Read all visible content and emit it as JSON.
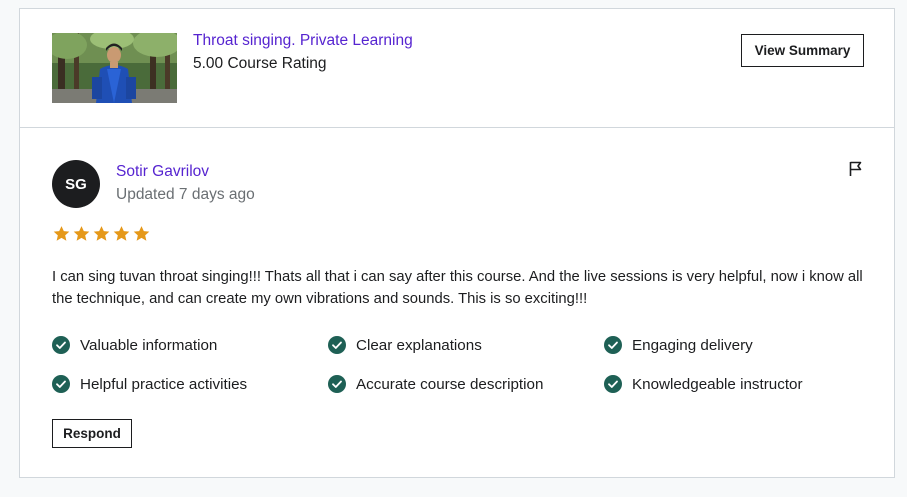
{
  "course": {
    "title": "Throat singing. Private Learning",
    "rating_text": "5.00 Course Rating",
    "view_summary_label": "View Summary",
    "thumbnail_icon": "course-thumbnail-image"
  },
  "review": {
    "avatar_initials": "SG",
    "reviewer_name": "Sotir Gavrilov",
    "updated": "Updated 7 days ago",
    "stars": 5,
    "star_color": "#e59819",
    "text": "I can sing tuvan throat singing!!! Thats all that i can say after this course. And the live sessions is very helpful, now i know all the technique, and can create my own vibrations and sounds. This is so exciting!!!",
    "tags": [
      "Valuable information",
      "Clear explanations",
      "Engaging delivery",
      "Helpful practice activities",
      "Accurate course description",
      "Knowledgeable instructor"
    ],
    "check_color": "#1e6055",
    "respond_label": "Respond",
    "flag_icon": "flag-icon"
  },
  "colors": {
    "link": "#5624d0",
    "muted": "#6a6f73",
    "border": "#d1d7dc"
  }
}
